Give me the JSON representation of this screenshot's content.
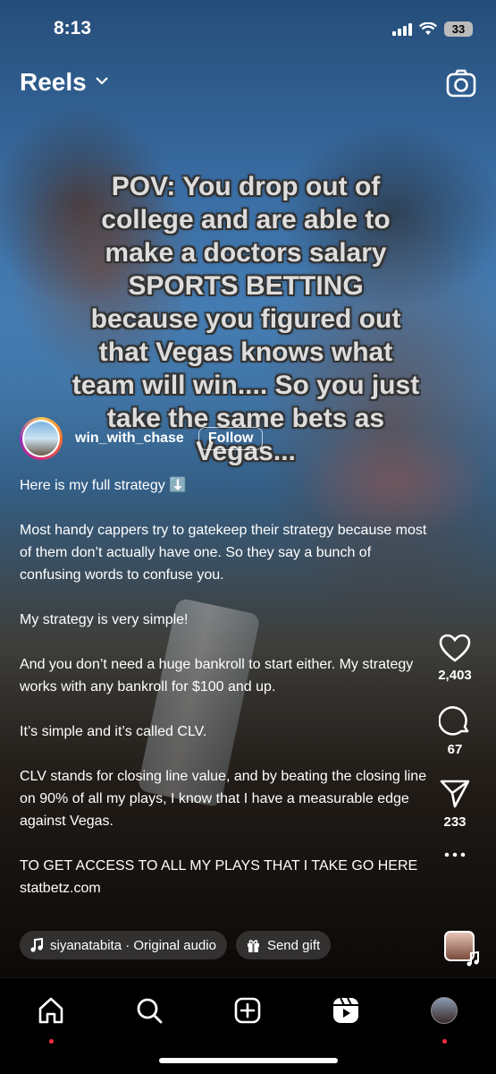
{
  "status_bar": {
    "time": "8:13",
    "battery": "33"
  },
  "header": {
    "title": "Reels"
  },
  "overlay_text": "POV: You drop out of college and are able to make a doctors salary SPORTS  BETTING because you figured out that Vegas knows what team will win.... So you just take the same bets as Vegas...",
  "author": {
    "username": "win_with_chase",
    "follow_label": "Follow"
  },
  "caption": {
    "paragraphs": [
      "Here is my full strategy ⬇️",
      "Most handy cappers try to gatekeep their strategy because most of them don’t actually have one. So they say a bunch of confusing words to confuse you.",
      "My strategy is very simple!",
      "And you don’t need a huge bankroll to start either. My strategy works with any bankroll for $100 and up.",
      "It’s simple and it’s called CLV.",
      "CLV stands for closing line value, and by beating the closing line on 90% of all my plays, I know that I have a measurable edge against Vegas.",
      "TO GET ACCESS TO ALL MY PLAYS THAT I TAKE GO HERE statbetz.com"
    ]
  },
  "chips": {
    "audio_label": "siyanatabita · Original audio",
    "gift_label": "Send gift"
  },
  "actions": {
    "likes": "2,403",
    "comments": "67",
    "shares": "233"
  },
  "nav": {
    "items": [
      "home-icon",
      "search-icon",
      "create-icon",
      "reels-icon",
      "profile-avatar"
    ]
  },
  "colors": {
    "notification_dot": "#ff3040",
    "background": "#000000"
  }
}
